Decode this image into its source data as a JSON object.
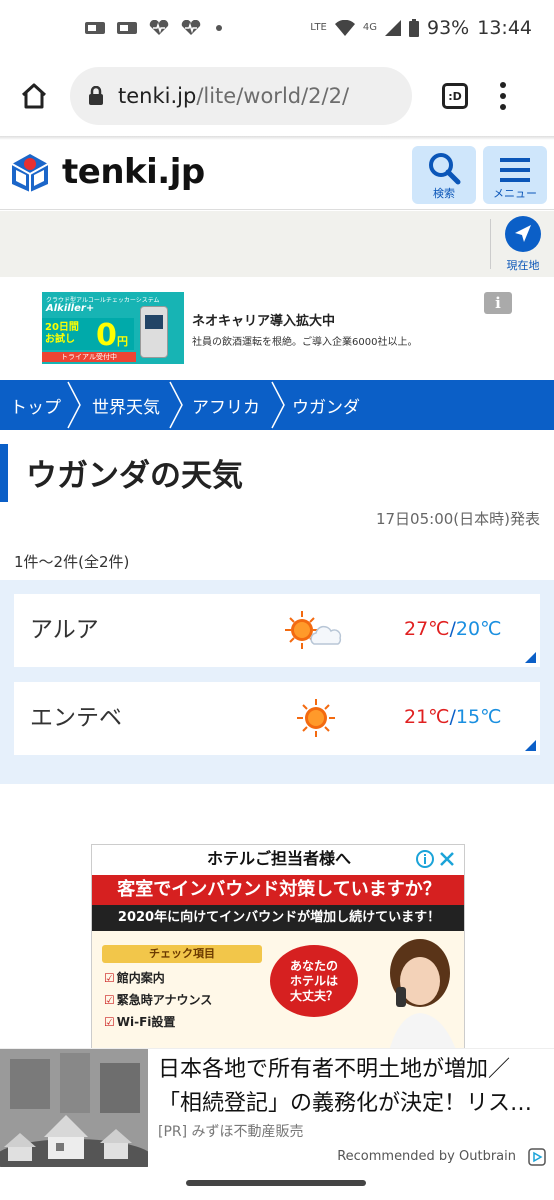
{
  "status_bar": {
    "network": "LTE",
    "signal": "4G",
    "battery": "93%",
    "time": "13:44"
  },
  "browser": {
    "url_host": "tenki.jp",
    "url_path": "/lite/world/2/2/",
    "tabs_label": ":D"
  },
  "header": {
    "logo_text": "tenki.jp",
    "search_label": "検索",
    "menu_label": "メニュー",
    "location_label": "現在地"
  },
  "ad_top": {
    "image_top_line": "クラウド型アルコールチェッカーシステム",
    "image_brand": "Alkiller+",
    "image_trial": "20日間\nお試し",
    "image_zero": "0",
    "image_yen": "円",
    "image_bar": "トライアル受付中",
    "title": "ネオキャリア導入拡大中",
    "description": "社員の飲酒運転を根絶。ご導入企業6000社以上。",
    "info_icon": "i"
  },
  "breadcrumb": {
    "items": [
      {
        "label": "トップ"
      },
      {
        "label": "世界天気"
      },
      {
        "label": "アフリカ"
      },
      {
        "label": "ウガンダ"
      }
    ]
  },
  "page": {
    "title": "ウガンダの天気",
    "issued": "17日05:00(日本時)発表",
    "count": "1件〜2件(全2件)"
  },
  "forecasts": [
    {
      "city": "アルア",
      "weather_icon": "sun-cloud-icon",
      "max": "27℃",
      "sep": "/",
      "min": "20℃"
    },
    {
      "city": "エンテベ",
      "weather_icon": "sun-icon",
      "max": "21℃",
      "sep": "/",
      "min": "15℃"
    }
  ],
  "ad_bottom": {
    "top_text": "ホテルご担当者様へ",
    "red_text": "客室でインバウンド対策していますか？",
    "black_text": "2020年に向けてインバウンドが増加し続けています！",
    "check_head": "チェック項目",
    "check_items": [
      "館内案内",
      "緊急時アナウンス",
      "Wi-Fi設置"
    ],
    "burst_text": "あなたの\nホテルは\n大丈夫？"
  },
  "outbrain": {
    "title_line1": "日本各地で所有者不明土地が増加／",
    "title_line2": "「相続登記」の義務化が決定！リス…",
    "source": "[PR] みずほ不動産販売",
    "recommended": "Recommended by Outbrain"
  },
  "colors": {
    "brand_blue": "#0b5fc7",
    "max_temp": "#e02020",
    "min_temp": "#1a8fe0",
    "list_bg": "#e6f0fb"
  }
}
